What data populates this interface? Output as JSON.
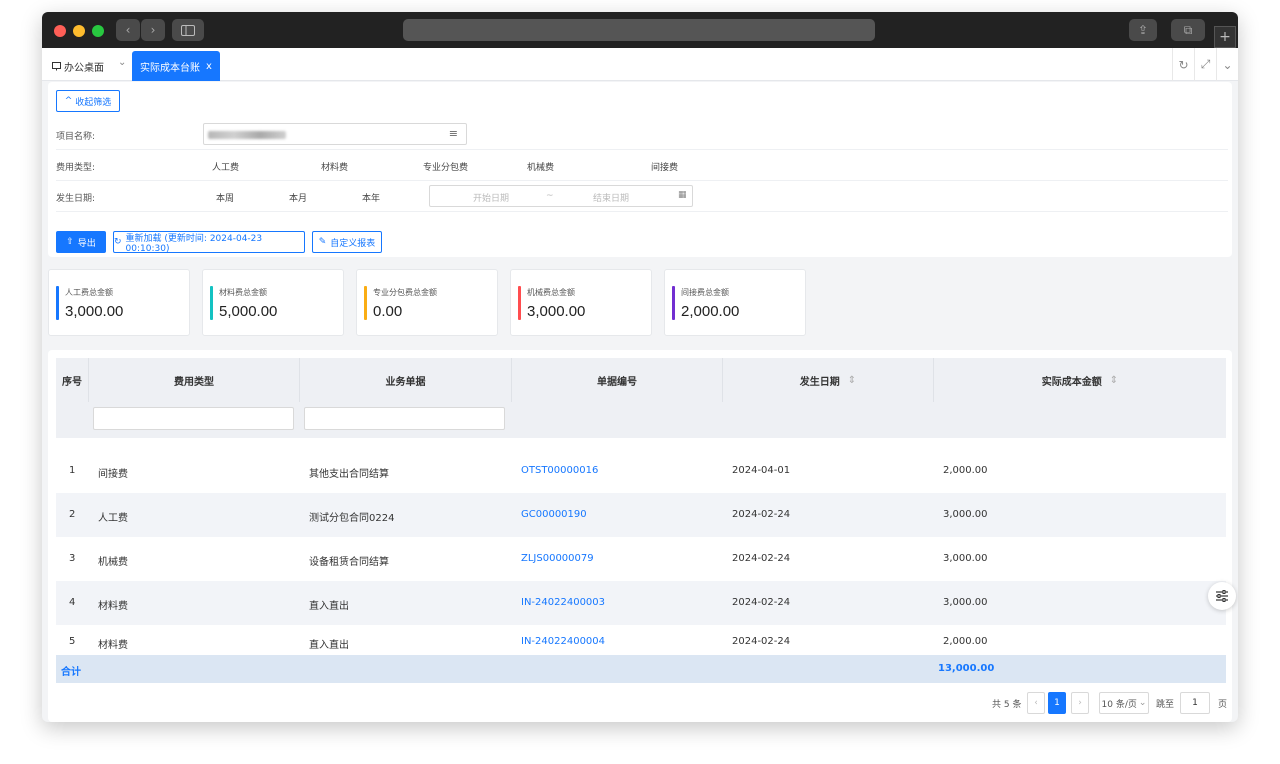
{
  "tabs": {
    "home_label": "办公桌面",
    "active_label": "实际成本台账",
    "close_glyph": "x"
  },
  "filters": {
    "collapse_label": "收起筛选",
    "project_label": "项目名称:",
    "cost_type_label": "费用类型:",
    "cost_types": [
      "人工费",
      "材料费",
      "专业分包费",
      "机械费",
      "间接费"
    ],
    "date_label": "发生日期:",
    "date_options": [
      "本周",
      "本月",
      "本年"
    ],
    "start_placeholder": "开始日期",
    "range_sep": "~",
    "end_placeholder": "结束日期"
  },
  "toolbar": {
    "export_label": "导出",
    "reload_label": "重新加载 (更新时间: 2024-04-23 00:10:30)",
    "custom_report_label": "自定义报表"
  },
  "cards": [
    {
      "title": "人工费总金额",
      "value": "3,000.00",
      "color": "#1677ff"
    },
    {
      "title": "材料费总金额",
      "value": "5,000.00",
      "color": "#13c2c2"
    },
    {
      "title": "专业分包费总金额",
      "value": "0.00",
      "color": "#faad14"
    },
    {
      "title": "机械费总金额",
      "value": "3,000.00",
      "color": "#ff4d4f"
    },
    {
      "title": "间接费总金额",
      "value": "2,000.00",
      "color": "#722ed1"
    }
  ],
  "table": {
    "columns": [
      "序号",
      "费用类型",
      "业务单据",
      "单据编号",
      "发生日期",
      "实际成本金额"
    ],
    "sort_glyph": "⇕",
    "rows": [
      {
        "index": "1",
        "type": "间接费",
        "doc": "其他支出合同结算",
        "code": "OTST00000016",
        "date": "2024-04-01",
        "amount": "2,000.00"
      },
      {
        "index": "2",
        "type": "人工费",
        "doc": "测试分包合同0224",
        "code": "GC00000190",
        "date": "2024-02-24",
        "amount": "3,000.00"
      },
      {
        "index": "3",
        "type": "机械费",
        "doc": "设备租赁合同结算",
        "code": "ZLJS00000079",
        "date": "2024-02-24",
        "amount": "3,000.00"
      },
      {
        "index": "4",
        "type": "材料费",
        "doc": "直入直出",
        "code": "IN-24022400003",
        "date": "2024-02-24",
        "amount": "3,000.00"
      },
      {
        "index": "5",
        "type": "材料费",
        "doc": "直入直出",
        "code": "IN-24022400004",
        "date": "2024-02-24",
        "amount": "2,000.00"
      }
    ],
    "total_label": "合计",
    "total_amount": "13,000.00"
  },
  "pagination": {
    "total_text": "共 5 条",
    "current_page": "1",
    "page_size": "10 条/页",
    "jump_label": "跳至",
    "jump_value": "1",
    "page_suffix": "页"
  }
}
